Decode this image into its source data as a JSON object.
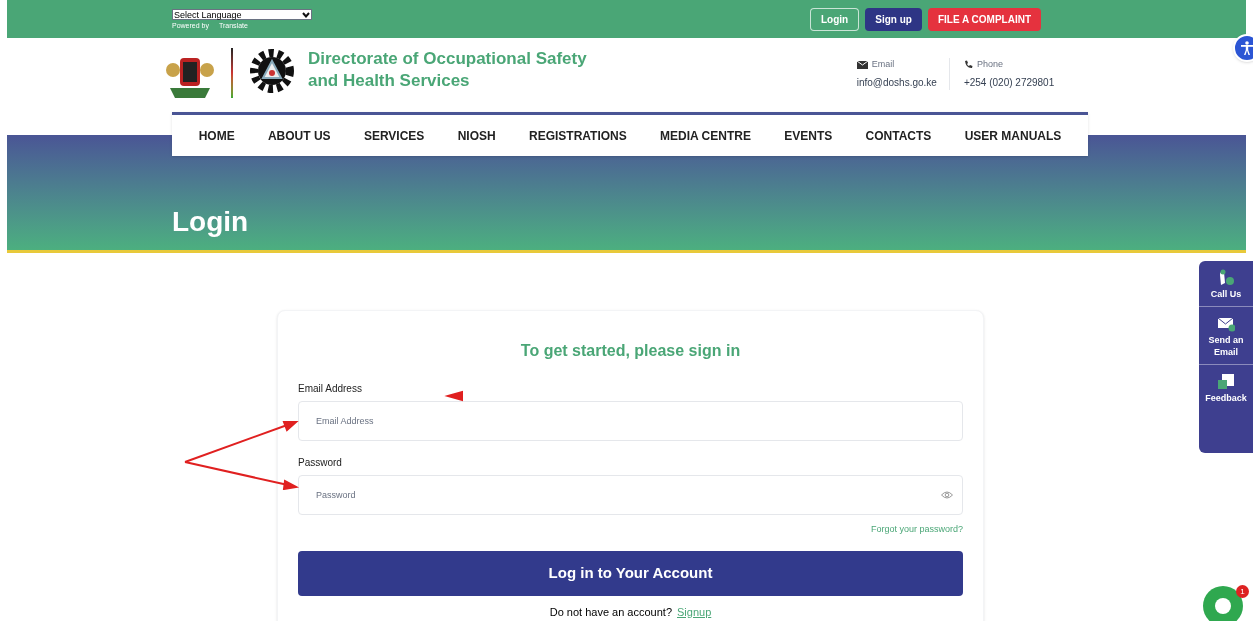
{
  "top_bar": {
    "language_select": "Select Language",
    "powered_by": "Powered by",
    "translate": "Translate",
    "buttons": [
      {
        "label": "Login",
        "kind": "outline"
      },
      {
        "label": "Sign up",
        "kind": "navy"
      },
      {
        "label": "FILE A COMPLAINT",
        "kind": "red"
      }
    ]
  },
  "header": {
    "title_line1": "Directorate of Occupational Safety",
    "title_line2": "and Health Services",
    "email_label": "Email",
    "email": "info@doshs.go.ke",
    "phone_label": "Phone",
    "phone": "+254 (020) 2729801"
  },
  "nav": [
    "HOME",
    "ABOUT US",
    "SERVICES",
    "NIOSH",
    "REGISTRATIONS",
    "MEDIA CENTRE",
    "EVENTS",
    "CONTACTS",
    "USER MANUALS"
  ],
  "banner": {
    "title": "Login"
  },
  "form": {
    "heading": "To get started, please sign in",
    "fields": [
      {
        "label": "Email Address",
        "placeholder": "Email Address",
        "kind": "text"
      },
      {
        "label": "Password",
        "placeholder": "Password",
        "kind": "password"
      }
    ],
    "forgot": "Forgot your password?",
    "submit": "Log in to Your Account",
    "no_account": "Do not have an account?",
    "signup": "Signup"
  },
  "side_panel": [
    {
      "label": "Call Us",
      "kind": "phone"
    },
    {
      "label": "Send an Email",
      "kind": "mail"
    },
    {
      "label": "Feedback",
      "kind": "feedback"
    }
  ],
  "chat": {
    "badge": "1"
  }
}
